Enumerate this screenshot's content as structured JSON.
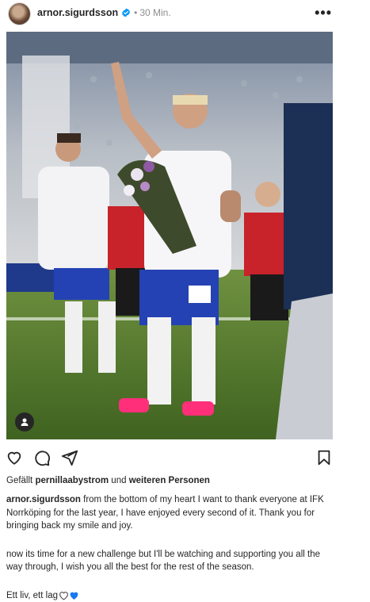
{
  "post": {
    "username": "arnor.sigurdsson",
    "separator": "•",
    "time": "30 Min.",
    "more_label": "•••"
  },
  "likes": {
    "prefix": "Gefällt ",
    "user": "pernillaabystrom",
    "middle": " und ",
    "suffix": "weiteren Personen"
  },
  "caption": {
    "username": "arnor.sigurdsson",
    "paragraph1": " from the bottom of my heart I want to thank everyone at IFK Norrköping for the last year, I have enjoyed every second of it. Thank you for bringing back my smile and joy.",
    "paragraph2": "now its time for a new challenge but I'll be watching and supporting you all the way through, I wish you all the best for the rest of the season.",
    "paragraph3": "Ett liv, ett lag"
  },
  "icons": {
    "verified": "verified-badge-icon",
    "more": "more-options-icon",
    "like": "heart-outline-icon",
    "comment": "comment-bubble-icon",
    "share": "paper-plane-icon",
    "save": "bookmark-icon",
    "tag": "user-tag-icon",
    "emoji_white_heart": "white-heart-emoji",
    "emoji_blue_heart": "blue-heart-emoji"
  },
  "colors": {
    "verified": "#0095f6",
    "blue_heart": "#1877f2",
    "secondary_text": "#8e8e8e"
  }
}
